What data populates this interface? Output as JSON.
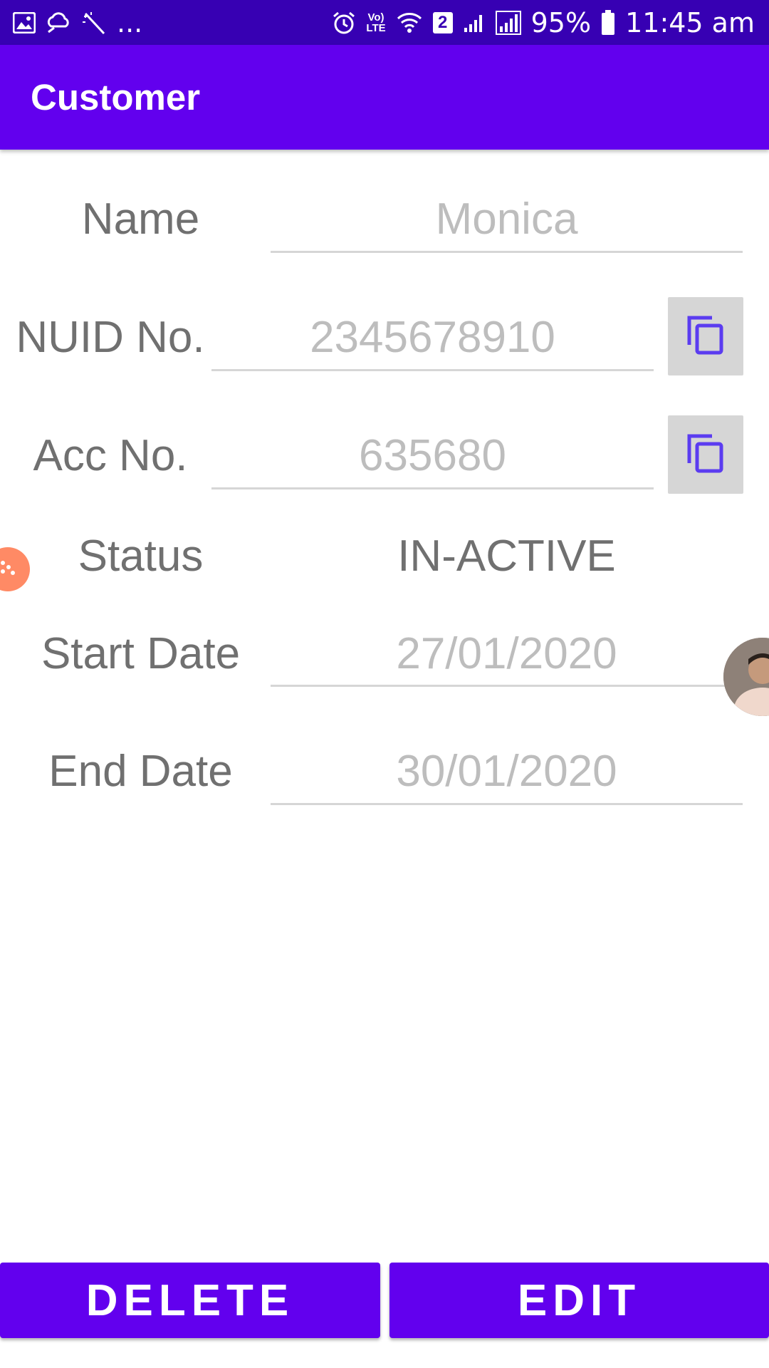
{
  "status_bar": {
    "overflow": "...",
    "volte_top": "Vo)",
    "volte_bottom": "LTE",
    "sim_number": "2",
    "battery_percent": "95%",
    "time": "11:45 am"
  },
  "app_bar": {
    "title": "Customer"
  },
  "form": {
    "name": {
      "label": "Name",
      "value": "Monica"
    },
    "nuid": {
      "label": "NUID No.",
      "value": "2345678910"
    },
    "acc": {
      "label": "Acc No.",
      "value": "635680"
    },
    "status": {
      "label": "Status",
      "value": "IN-ACTIVE"
    },
    "start_date": {
      "label": "Start Date",
      "value": "27/01/2020"
    },
    "end_date": {
      "label": "End Date",
      "value": "30/01/2020"
    }
  },
  "buttons": {
    "delete": "DELETE",
    "edit": "EDIT"
  },
  "colors": {
    "status_bar": "#3700b3",
    "primary": "#6200ee",
    "copy_icon": "#5b3cf0",
    "label_text": "#707070",
    "value_text": "#bdbdbd"
  },
  "icons": {
    "status_left": [
      "gallery-icon",
      "cloud-link-icon",
      "magic-wand-icon"
    ],
    "status_right": [
      "alarm-icon",
      "volte-icon",
      "wifi-icon",
      "sim-icon",
      "signal-icon",
      "signal-icon",
      "battery-icon"
    ],
    "copy": "copy-icon"
  }
}
